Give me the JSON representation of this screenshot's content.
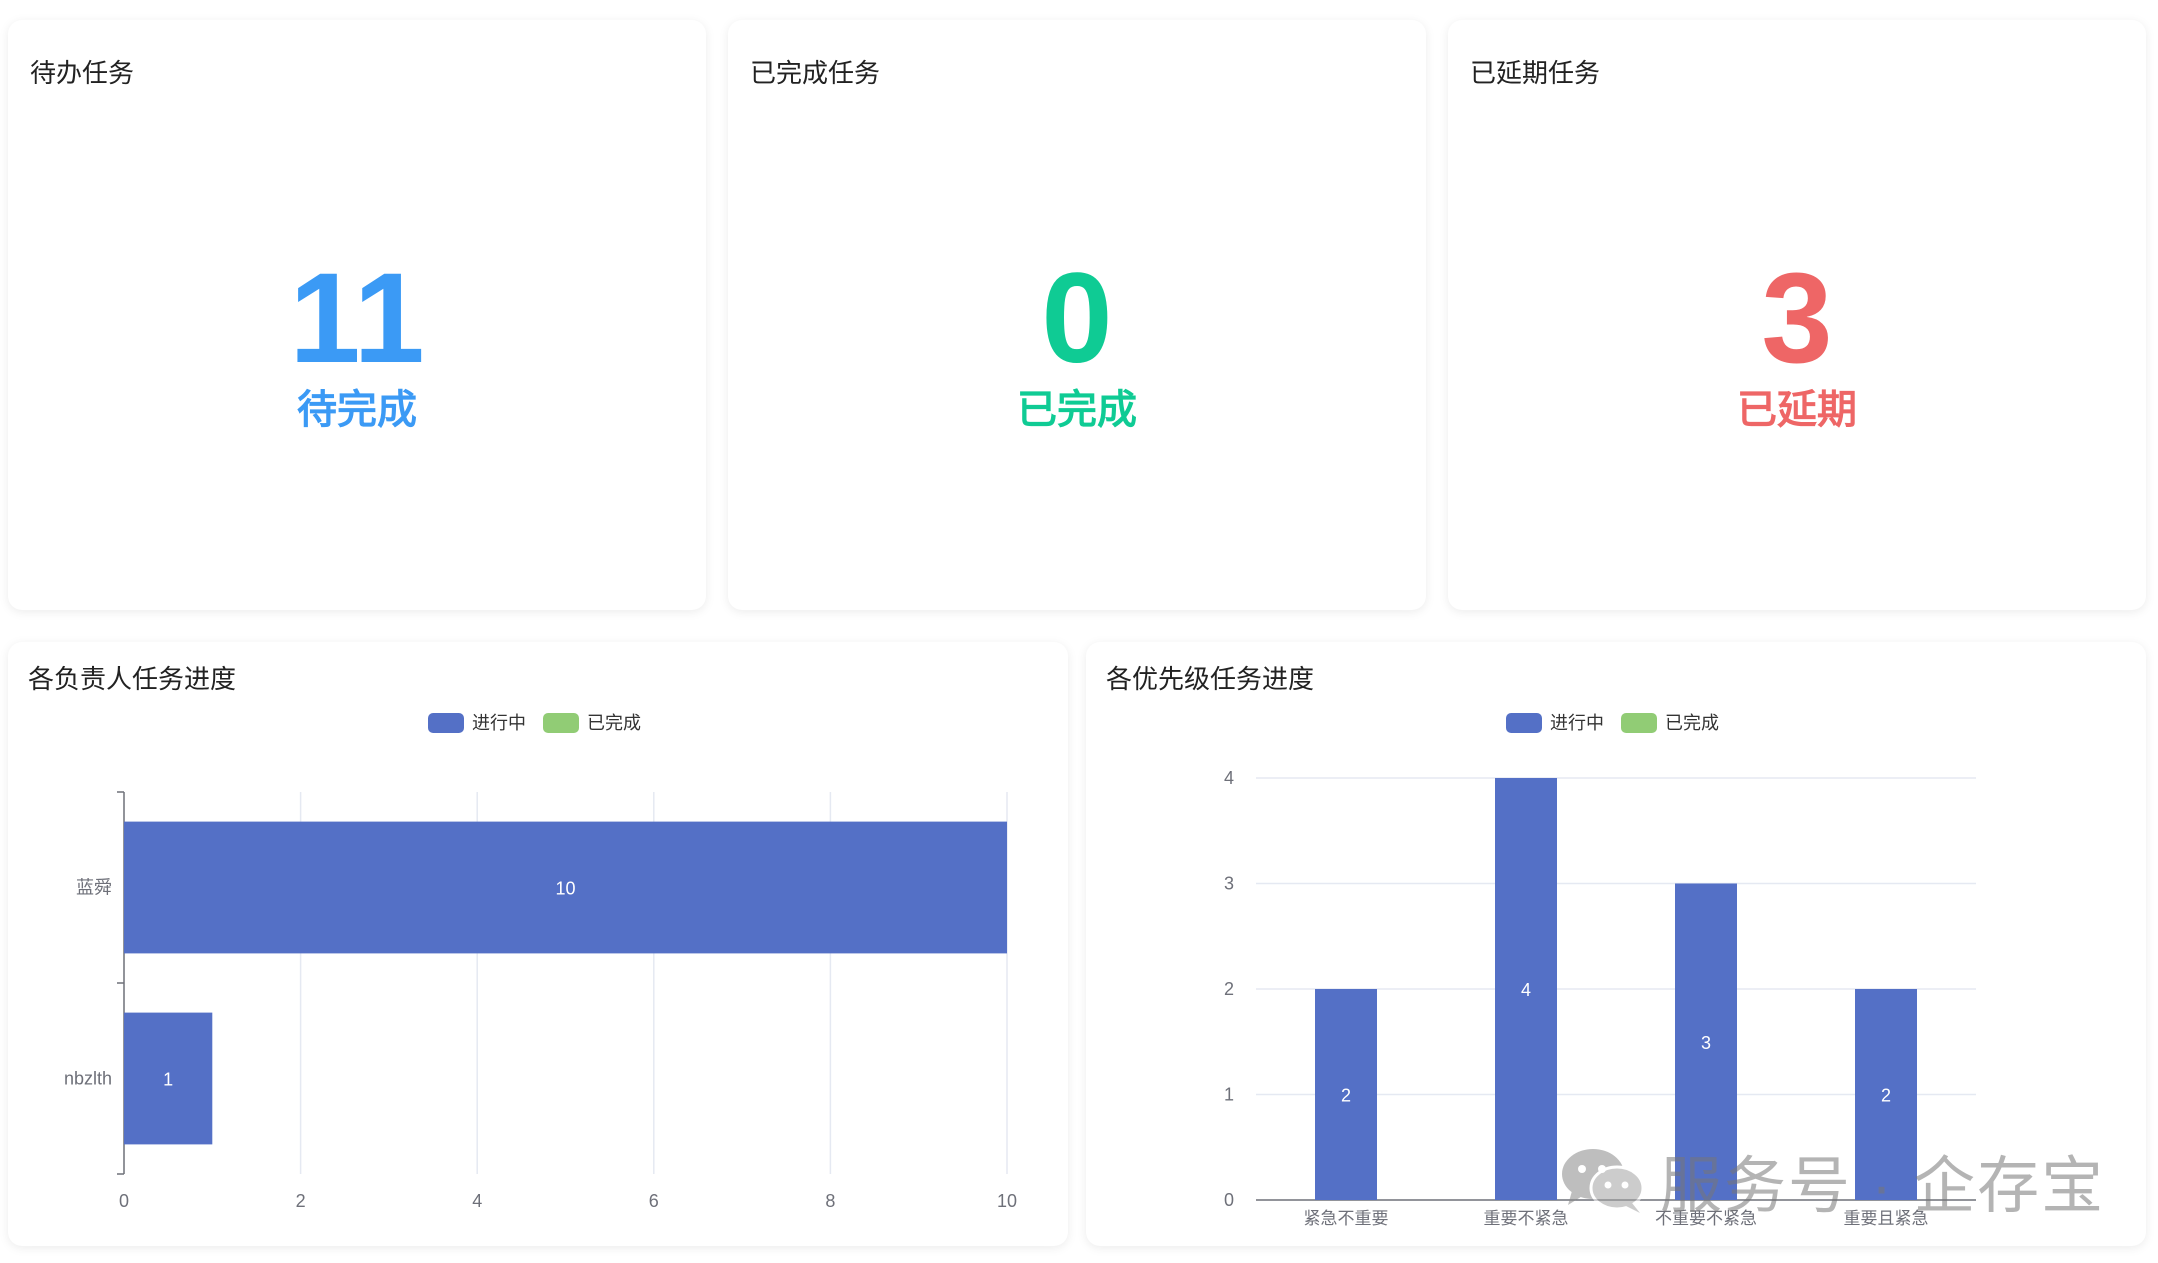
{
  "colors": {
    "pending": "#3b9af5",
    "done": "#0fcb94",
    "overdue": "#ee6666",
    "series_in_progress": "#5470c6",
    "series_done": "#91cc75",
    "grid": "#e5e9f2",
    "axis": "#6e7079"
  },
  "cards": {
    "pending": {
      "title": "待办任务",
      "value": "11",
      "label": "待完成"
    },
    "done": {
      "title": "已完成任务",
      "value": "0",
      "label": "已完成"
    },
    "overdue": {
      "title": "已延期任务",
      "value": "3",
      "label": "已延期"
    }
  },
  "owner_chart": {
    "title": "各负责人任务进度",
    "legend": [
      "进行中",
      "已完成"
    ]
  },
  "priority_chart": {
    "title": "各优先级任务进度",
    "legend": [
      "进行中",
      "已完成"
    ]
  },
  "watermark": {
    "icon": "wechat-icon",
    "text": "服务号 · 企存宝"
  },
  "chart_data": [
    {
      "type": "bar",
      "orientation": "horizontal",
      "title": "各负责人任务进度",
      "categories": [
        "蓝舜",
        "nbzlth"
      ],
      "series": [
        {
          "name": "进行中",
          "values": [
            10,
            1
          ]
        },
        {
          "name": "已完成",
          "values": [
            0,
            0
          ]
        }
      ],
      "xlim": [
        0,
        10
      ],
      "xticks": [
        0,
        2,
        4,
        6,
        8,
        10
      ],
      "grid": true,
      "legend": "top-center",
      "data_labels": true
    },
    {
      "type": "bar",
      "orientation": "vertical",
      "title": "各优先级任务进度",
      "categories": [
        "紧急不重要",
        "重要不紧急",
        "不重要不紧急",
        "重要且紧急"
      ],
      "series": [
        {
          "name": "进行中",
          "values": [
            2,
            4,
            3,
            2
          ]
        },
        {
          "name": "已完成",
          "values": [
            0,
            0,
            0,
            0
          ]
        }
      ],
      "ylim": [
        0,
        4
      ],
      "yticks": [
        0,
        1,
        2,
        3,
        4
      ],
      "grid": true,
      "legend": "top-center",
      "data_labels": true
    }
  ]
}
